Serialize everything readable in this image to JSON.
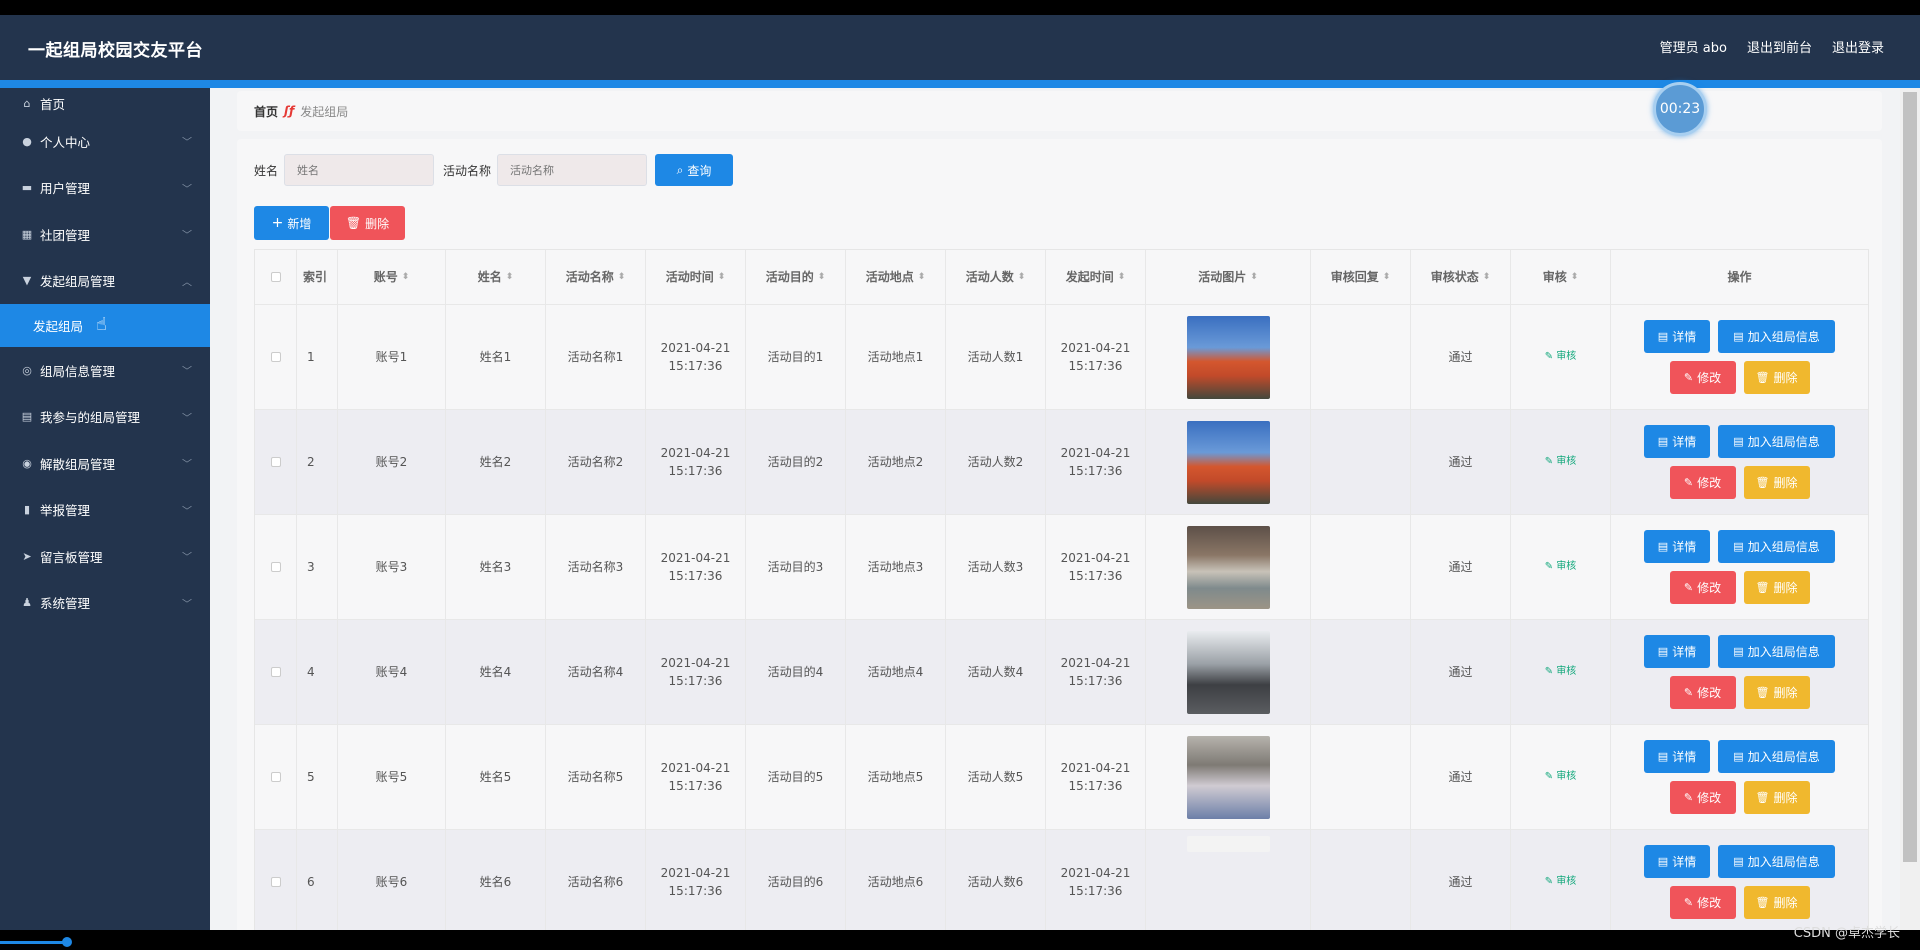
{
  "header": {
    "title": "一起组局校园交友平台",
    "links": [
      "管理员 abo",
      "退出到前台",
      "退出登录"
    ]
  },
  "sidebar": {
    "items": [
      {
        "label": "首页",
        "icon": "home-icon",
        "chevron": false
      },
      {
        "label": "个人中心",
        "icon": "user-icon",
        "chevron": true
      },
      {
        "label": "用户管理",
        "icon": "briefcase-icon",
        "chevron": true
      },
      {
        "label": "社团管理",
        "icon": "grid-icon",
        "chevron": true
      },
      {
        "label": "发起组局管理",
        "icon": "flag-icon",
        "chevron": true,
        "expanded": true
      },
      {
        "label": "组局信息管理",
        "icon": "compass-icon",
        "chevron": true
      },
      {
        "label": "我参与的组局管理",
        "icon": "clipboard-icon",
        "chevron": true
      },
      {
        "label": "解散组局管理",
        "icon": "location-icon",
        "chevron": true
      },
      {
        "label": "举报管理",
        "icon": "bar-chart-icon",
        "chevron": true
      },
      {
        "label": "留言板管理",
        "icon": "send-icon",
        "chevron": true
      },
      {
        "label": "系统管理",
        "icon": "person-icon",
        "chevron": true
      }
    ],
    "submenu_active": "发起组局"
  },
  "breadcrumb": {
    "home": "首页",
    "current": "发起组局"
  },
  "timer": "00:23",
  "search": {
    "name_label": "姓名",
    "name_placeholder": "姓名",
    "activity_label": "活动名称",
    "activity_placeholder": "活动名称",
    "query_button": "查询"
  },
  "actions": {
    "add": "新增",
    "delete": "删除"
  },
  "table": {
    "headers": [
      "索引",
      "账号",
      "姓名",
      "活动名称",
      "活动时间",
      "活动目的",
      "活动地点",
      "活动人数",
      "发起时间",
      "活动图片",
      "审核回复",
      "审核状态",
      "审核",
      "操作"
    ],
    "rows": [
      {
        "index": "1",
        "account": "账号1",
        "name": "姓名1",
        "activity": "活动名称1",
        "time": "2021-04-21 15:17:36",
        "purpose": "活动目的1",
        "place": "活动地点1",
        "people": "活动人数1",
        "created": "2021-04-21 15:17:36",
        "reply": "",
        "status": "通过",
        "audit": "审核"
      },
      {
        "index": "2",
        "account": "账号2",
        "name": "姓名2",
        "activity": "活动名称2",
        "time": "2021-04-21 15:17:36",
        "purpose": "活动目的2",
        "place": "活动地点2",
        "people": "活动人数2",
        "created": "2021-04-21 15:17:36",
        "reply": "",
        "status": "通过",
        "audit": "审核"
      },
      {
        "index": "3",
        "account": "账号3",
        "name": "姓名3",
        "activity": "活动名称3",
        "time": "2021-04-21 15:17:36",
        "purpose": "活动目的3",
        "place": "活动地点3",
        "people": "活动人数3",
        "created": "2021-04-21 15:17:36",
        "reply": "",
        "status": "通过",
        "audit": "审核"
      },
      {
        "index": "4",
        "account": "账号4",
        "name": "姓名4",
        "activity": "活动名称4",
        "time": "2021-04-21 15:17:36",
        "purpose": "活动目的4",
        "place": "活动地点4",
        "people": "活动人数4",
        "created": "2021-04-21 15:17:36",
        "reply": "",
        "status": "通过",
        "audit": "审核"
      },
      {
        "index": "5",
        "account": "账号5",
        "name": "姓名5",
        "activity": "活动名称5",
        "time": "2021-04-21 15:17:36",
        "purpose": "活动目的5",
        "place": "活动地点5",
        "people": "活动人数5",
        "created": "2021-04-21 15:17:36",
        "reply": "",
        "status": "通过",
        "audit": "审核"
      },
      {
        "index": "6",
        "account": "账号6",
        "name": "姓名6",
        "activity": "活动名称6",
        "time": "2021-04-21 15:17:36",
        "purpose": "活动目的6",
        "place": "活动地点6",
        "people": "活动人数6",
        "created": "2021-04-21 15:17:36",
        "reply": "",
        "status": "通过",
        "audit": "审核"
      }
    ],
    "row_buttons": {
      "detail": "详情",
      "join": "加入组局信息",
      "edit": "修改",
      "remove": "删除"
    }
  },
  "colors": {
    "header_bg": "#23344d",
    "accent": "#1e88e5",
    "danger": "#f0545a",
    "warning": "#f0b82e",
    "success": "#13a87c"
  },
  "watermark": "CSDN @卓杰学长"
}
